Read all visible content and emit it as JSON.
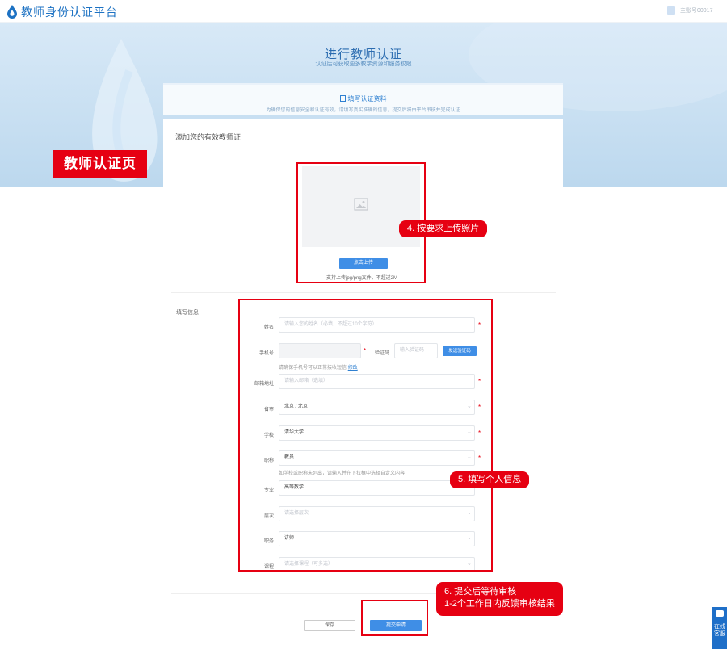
{
  "header": {
    "brand": "教师身份认证平台",
    "user": "主账号00017"
  },
  "hero": {
    "title": "进行教师认证",
    "subtitle": "认证后可获取更多教学资源和服务权限"
  },
  "step": {
    "title": "填写认证资料",
    "description": "为确保您的信息安全和认证有效，请填写真实准确的信息，提交后将由平台审核并完成认证"
  },
  "annotations": {
    "page_label": "教师认证页",
    "upload_callout": "4. 按要求上传照片",
    "info_callout": "5. 填写个人信息",
    "submit_callout_line1": "6. 提交后等待审核",
    "submit_callout_line2": "1-2个工作日内反馈审核结果"
  },
  "upload": {
    "section_title": "添加您的有效教师证",
    "button": "点击上传",
    "hint": "支持上传jpg/png文件，不超过2M"
  },
  "personal": {
    "section_title": "填写信息",
    "name": {
      "label": "姓名",
      "placeholder": "请输入您的姓名（必填，不超过10个字符）"
    },
    "phone": {
      "label": "手机号",
      "value": ""
    },
    "verify": {
      "label": "验证码",
      "placeholder": "输入验证码",
      "button": "发送验证码"
    },
    "phone_help": "请确保手机号可以正常接收短信",
    "phone_help_link": "修改",
    "email": {
      "label": "邮箱地址",
      "placeholder": "请输入邮箱（选填）"
    },
    "province": {
      "label": "省市",
      "value": "北京 / 北京"
    },
    "school": {
      "label": "学校",
      "value": "清华大学"
    },
    "title": {
      "label": "职称",
      "value": "教员"
    },
    "title_help": "如学校或职称未列出，请输入并在下拉框中选择自定义内容",
    "subject": {
      "label": "专业",
      "value": "高等数学"
    },
    "level": {
      "label": "层次",
      "placeholder": "请选择层次"
    },
    "position": {
      "label": "职务",
      "value": "讲师"
    },
    "course": {
      "label": "课程",
      "placeholder": "请选择课程（可多选）"
    }
  },
  "footer": {
    "save": "保存",
    "submit": "提交申请"
  },
  "side": {
    "label": "在线客服"
  },
  "colors": {
    "accent": "#3f8ee6",
    "highlight": "#e60012",
    "hero_bg": "#cfe3f4"
  }
}
